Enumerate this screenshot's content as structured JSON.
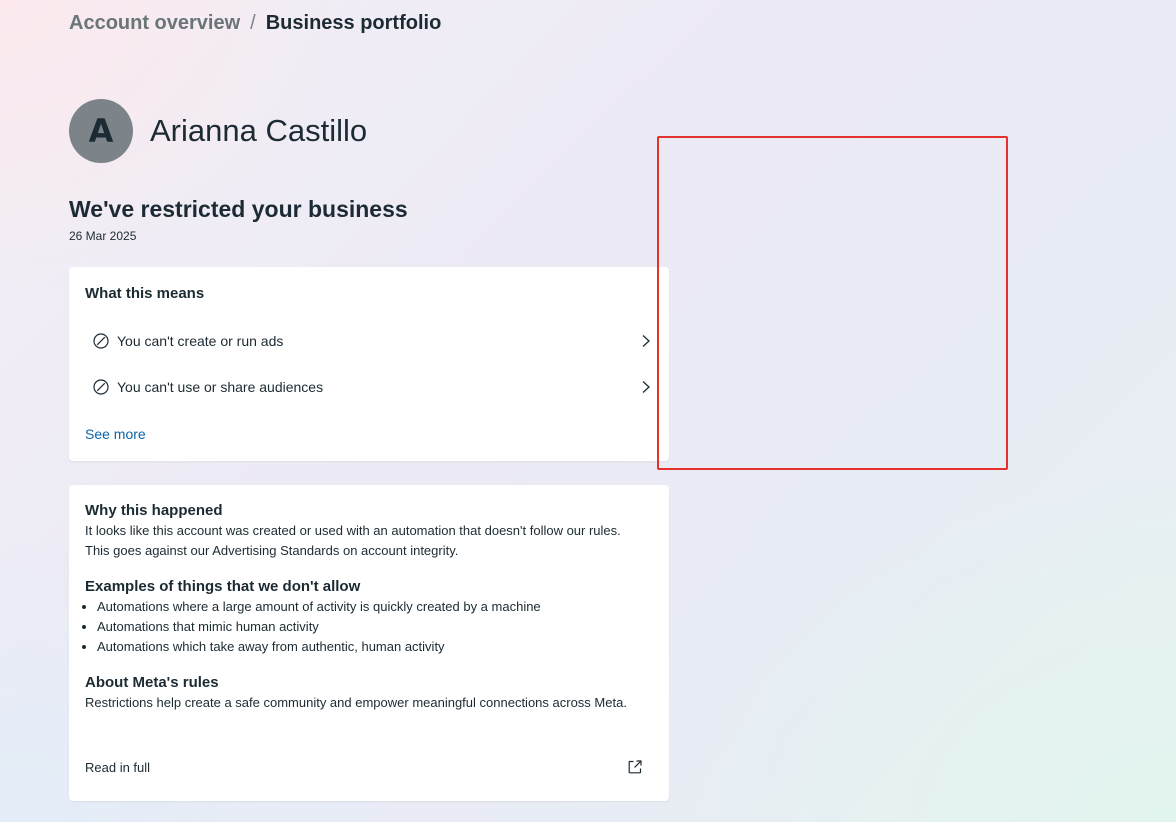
{
  "breadcrumb": {
    "parent": "Account overview",
    "separator": "/",
    "current": "Business portfolio"
  },
  "profile": {
    "avatar_initial": "A",
    "name": "Arianna Castillo"
  },
  "restriction": {
    "headline": "We've restricted your business",
    "date": "26 Mar 2025"
  },
  "what_this_means": {
    "title": "What this means",
    "items": [
      {
        "label": "You can't create or run ads",
        "icon": "prohibited-icon"
      },
      {
        "label": "You can't use or share audiences",
        "icon": "prohibited-icon"
      }
    ],
    "see_more": "See more"
  },
  "why_this_happened": {
    "title": "Why this happened",
    "body": "It looks like this account was created or used with an automation that doesn't follow our rules. This goes against our Advertising Standards on account integrity.",
    "examples_title": "Examples of things that we don't allow",
    "examples": [
      "Automations where a large amount of activity is quickly created by a machine",
      "Automations that mimic human activity",
      "Automations which take away from authentic, human activity"
    ],
    "rules_title": "About Meta's rules",
    "rules_body": "Restrictions help create a safe community and empower meaningful connections across Meta.",
    "read_in_full": "Read in full",
    "read_icon": "external-link-icon"
  },
  "colors": {
    "link": "#0a66a8",
    "text": "#1c2b33",
    "annotation_border": "#e5322d"
  }
}
